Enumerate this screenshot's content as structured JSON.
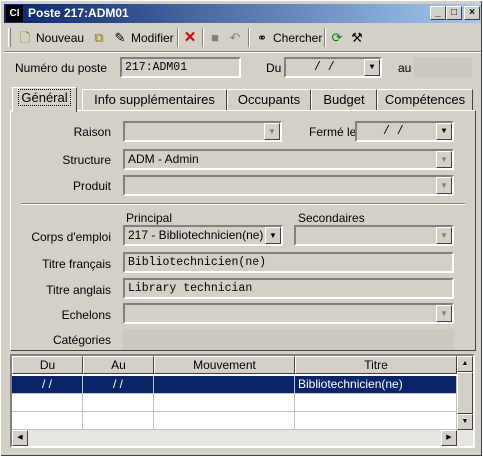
{
  "window": {
    "title": "Poste 217:ADM01",
    "app_icon_text": "CI",
    "controls": {
      "minimize": "_",
      "maximize": "□",
      "close": "×"
    }
  },
  "toolbar": {
    "new_label": "Nouveau",
    "edit_label": "Modifier",
    "search_label": "Chercher"
  },
  "header": {
    "numero_label": "Numéro du poste",
    "numero_value": "217:ADM01",
    "du_label": "Du",
    "du_value": "/   /",
    "au_label": "au",
    "au_value": ""
  },
  "tabs": [
    {
      "label": "Général",
      "active": true
    },
    {
      "label": "Info supplémentaires",
      "active": false
    },
    {
      "label": "Occupants",
      "active": false
    },
    {
      "label": "Budget",
      "active": false
    },
    {
      "label": "Compétences",
      "active": false
    }
  ],
  "general": {
    "raison_label": "Raison",
    "raison_value": "",
    "ferme_label": "Fermé le",
    "ferme_value": "/   /",
    "structure_label": "Structure",
    "structure_value": "ADM - Admin",
    "produit_label": "Produit",
    "produit_value": "",
    "principal_label": "Principal",
    "secondaires_label": "Secondaires",
    "corps_label": "Corps d'emploi",
    "corps_value": "217 - Bibliotechnicien(ne)",
    "secondaires_value": "",
    "titre_fr_label": "Titre français",
    "titre_fr_value": "Bibliotechnicien(ne)",
    "titre_en_label": "Titre anglais",
    "titre_en_value": "Library technician",
    "echelons_label": "Echelons",
    "echelons_value": "",
    "categories_label": "Catégories",
    "categories_value": ""
  },
  "grid": {
    "columns": [
      "Du",
      "Au",
      "Mouvement",
      "Titre"
    ],
    "rows": [
      {
        "du": "/ /",
        "au": "/ /",
        "mouvement": "",
        "titre": "Bibliotechnicien(ne)"
      }
    ]
  }
}
